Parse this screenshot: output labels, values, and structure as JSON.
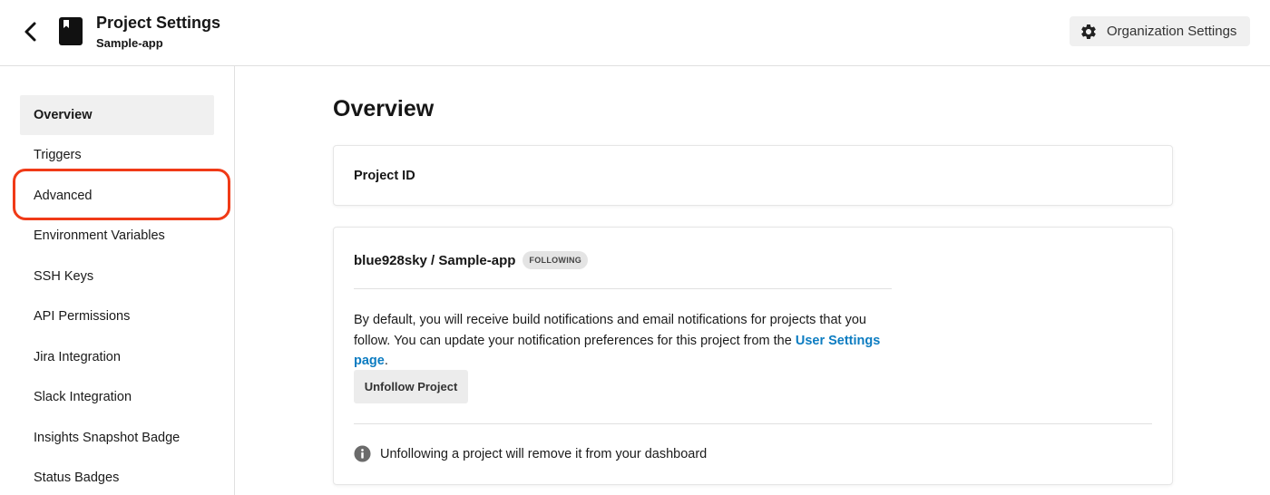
{
  "header": {
    "title": "Project Settings",
    "subtitle": "Sample-app",
    "org_settings_label": "Organization Settings",
    "icons": {
      "back": "chevron-left-icon",
      "project": "bookmark-book-icon",
      "org": "gear-icon"
    }
  },
  "sidebar": {
    "items": [
      {
        "label": "Overview",
        "active": true
      },
      {
        "label": "Triggers",
        "active": false
      },
      {
        "label": "Advanced",
        "active": false,
        "highlighted": true
      },
      {
        "label": "Environment Variables",
        "active": false
      },
      {
        "label": "SSH Keys",
        "active": false
      },
      {
        "label": "API Permissions",
        "active": false
      },
      {
        "label": "Jira Integration",
        "active": false
      },
      {
        "label": "Slack Integration",
        "active": false
      },
      {
        "label": "Insights Snapshot Badge",
        "active": false
      },
      {
        "label": "Status Badges",
        "active": false
      }
    ]
  },
  "main": {
    "title": "Overview",
    "project_id_label": "Project ID",
    "repo_name": "blue928sky / Sample-app",
    "follow_badge": "FOLLOWING",
    "description_prefix": "By default, you will receive build notifications and email notifications for projects that you follow. You can update your notification preferences for this project from the ",
    "description_link": "User Settings page",
    "description_suffix": ".",
    "unfollow_label": "Unfollow Project",
    "info_text": "Unfollowing a project will remove it from your dashboard"
  },
  "colors": {
    "accent_link": "#0c7cc1",
    "highlight": "#f03a17",
    "active_bg": "#f0f0f0"
  }
}
